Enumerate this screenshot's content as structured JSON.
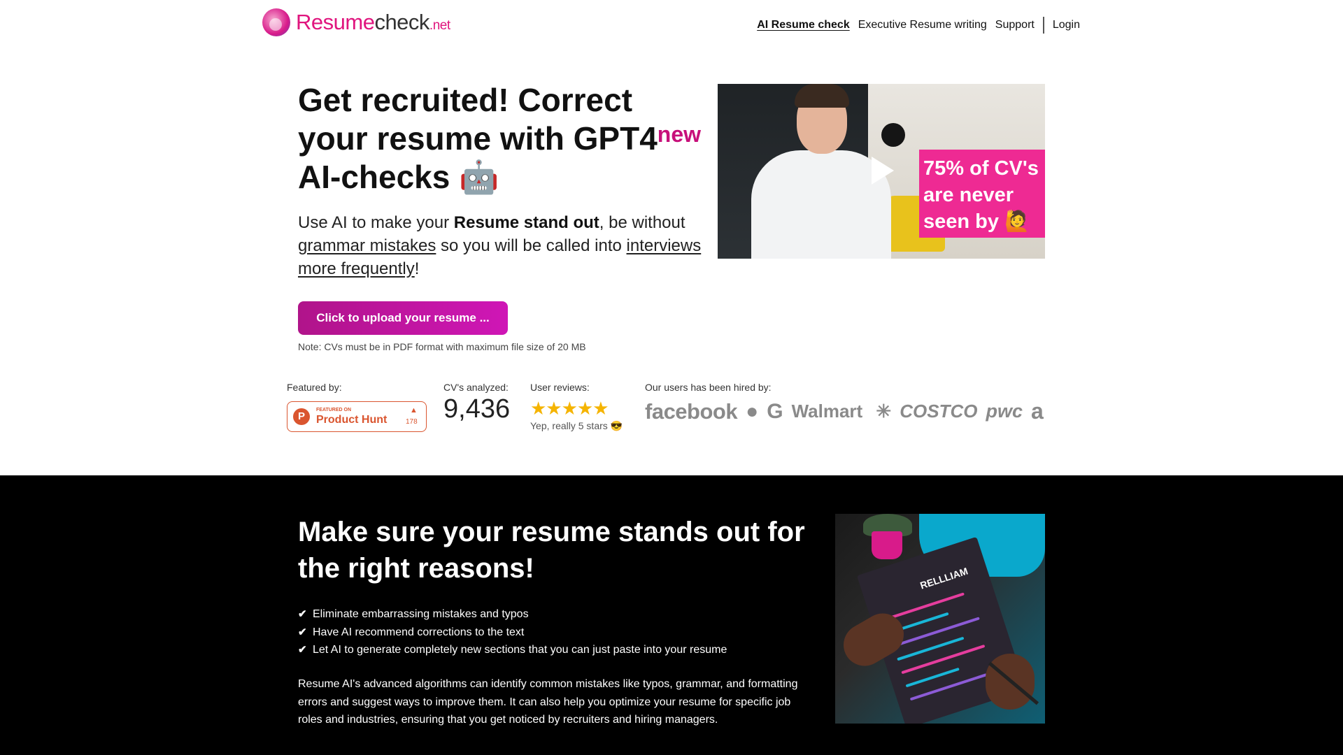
{
  "header": {
    "logo": {
      "brand": "Resume",
      "check": "check",
      "tld": ".net"
    },
    "nav": [
      {
        "label": "AI Resume check",
        "active": true
      },
      {
        "label": "Executive Resume writing"
      },
      {
        "label": "Support"
      },
      {
        "label": "Login"
      }
    ]
  },
  "hero": {
    "title_part1": "Get recruited! Correct your resume with GPT4",
    "title_sup": "new",
    "title_part2": " AI-checks 🤖",
    "subtitle": {
      "t1": "Use AI to make your ",
      "bold": "Resume stand out",
      "t2": ", be without ",
      "u1": "grammar mistakes",
      "t3": " so you will be called into ",
      "u2": "interviews more frequently",
      "t4": "!"
    },
    "upload_button": "Click to upload your resume ...",
    "note": "Note: CVs must be in PDF format with maximum file size of 20 MB"
  },
  "video": {
    "overlay_text": "75% of CV's are never seen by 🙋",
    "play_icon": "play-icon"
  },
  "stats": {
    "featured_label": "Featured by:",
    "producthunt": {
      "small": "FEATURED ON",
      "name": "Product Hunt",
      "count": "178"
    },
    "cv_label": "CV's analyzed:",
    "cv_count": "9,436",
    "reviews_label": "User reviews:",
    "rating": 5,
    "rating_note": "Yep, really 5 stars 😎",
    "hired_label": "Our users has been hired by:",
    "hirers": [
      "facebook",
      "Walmart",
      "COSTCO",
      "pwc",
      "a"
    ]
  },
  "dark": {
    "title": "Make sure your resume stands out for the right reasons!",
    "features": [
      "Eliminate embarrassing mistakes and typos",
      "Have AI recommend corrections to the text",
      "Let AI to generate completely new sections that you can just paste into your resume"
    ],
    "paragraph": "Resume AI's advanced algorithms can identify common mistakes like typos, grammar, and formatting errors and suggest ways to improve them. It can also help you optimize your resume for specific job roles and industries, ensuring that you get noticed by recruiters and hiring managers.",
    "image_text": "RELLLIAM"
  },
  "colors": {
    "brand": "#e0157e",
    "button": "#c0149e",
    "dark_bg": "#000000",
    "star": "#f5b400",
    "producthunt": "#da552f"
  }
}
